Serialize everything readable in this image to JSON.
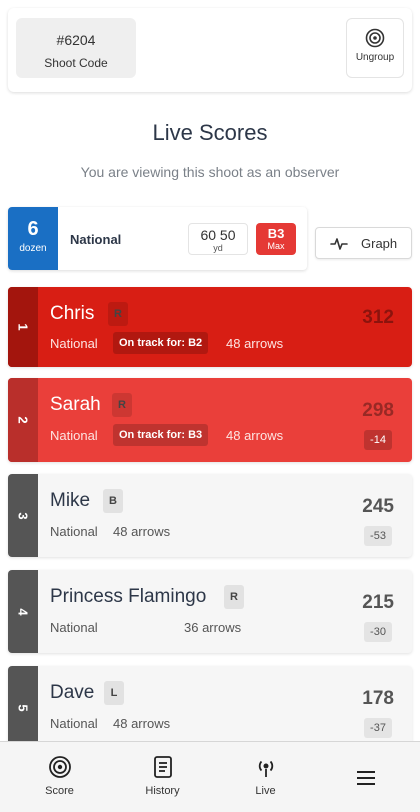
{
  "header": {
    "shoot_code": "#6204",
    "shoot_code_label": "Shoot Code",
    "ungroup_label": "Ungroup"
  },
  "title": "Live Scores",
  "subtitle": "You are viewing this shoot as an observer",
  "round": {
    "dozen_count": "6",
    "dozen_label": "dozen",
    "name": "National",
    "distances": "60 50",
    "distance_unit": "yd",
    "max_class": "B3",
    "max_label": "Max"
  },
  "graph_label": "Graph",
  "scores": [
    {
      "rank": "1",
      "name": "Chris",
      "bow": "R",
      "round": "National",
      "on_track": "On track for: B2",
      "arrows": "48 arrows",
      "score": "312",
      "diff": ""
    },
    {
      "rank": "2",
      "name": "Sarah",
      "bow": "R",
      "round": "National",
      "on_track": "On track for: B3",
      "arrows": "48 arrows",
      "score": "298",
      "diff": "-14"
    },
    {
      "rank": "3",
      "name": "Mike",
      "bow": "B",
      "round": "National",
      "on_track": "",
      "arrows": "48 arrows",
      "score": "245",
      "diff": "-53"
    },
    {
      "rank": "4",
      "name": "Princess Flamingo",
      "bow": "R",
      "round": "National",
      "on_track": "",
      "arrows": "36 arrows",
      "score": "215",
      "diff": "-30"
    },
    {
      "rank": "5",
      "name": "Dave",
      "bow": "L",
      "round": "National",
      "on_track": "",
      "arrows": "48 arrows",
      "score": "178",
      "diff": "-37"
    }
  ],
  "nav": {
    "score": "Score",
    "history": "History",
    "live": "Live"
  },
  "colors": {
    "leader": "#d81e14",
    "second": "#ea3f3a",
    "dozen": "#1a6fc4",
    "max_badge": "#e53935"
  }
}
